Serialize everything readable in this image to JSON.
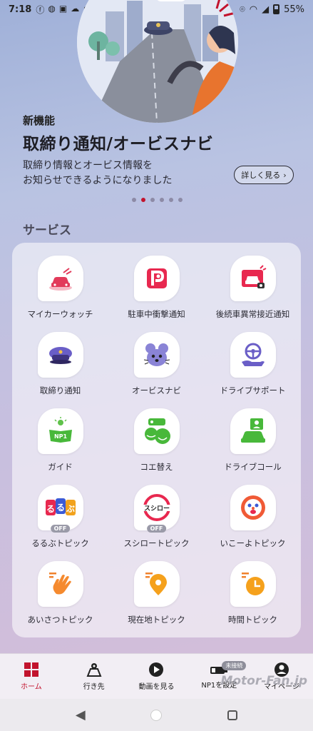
{
  "status_bar": {
    "time": "7:18",
    "battery": "55%",
    "left_icons": [
      "facebook-icon",
      "line-icon",
      "tiktok-icon",
      "weather-icon",
      "dot-icon"
    ],
    "right_icons": [
      "location-icon",
      "wifi-icon",
      "signal-icon",
      "battery-icon"
    ]
  },
  "hero": {
    "badge": "新機能",
    "title": "取締り通知/オービスナビ",
    "description_line1": "取締り情報とオービス情報を",
    "description_line2": "お知らせできるようになりました",
    "more_label": "詳しく見る",
    "pager": {
      "count": 6,
      "active_index": 1
    }
  },
  "services": {
    "section_title": "サービス",
    "items": [
      {
        "label": "マイカーウォッチ",
        "icon": "car-watch-icon"
      },
      {
        "label": "駐車中衝撃通知",
        "icon": "parking-camera-icon"
      },
      {
        "label": "後続車異常接近通知",
        "icon": "rear-car-alert-icon"
      },
      {
        "label": "取締り通知",
        "icon": "police-cap-icon"
      },
      {
        "label": "オービスナビ",
        "icon": "mouse-mascot-icon"
      },
      {
        "label": "ドライブサポート",
        "icon": "steering-hand-icon"
      },
      {
        "label": "ガイド",
        "icon": "guide-book-icon"
      },
      {
        "label": "コエ替え",
        "icon": "voice-change-icon"
      },
      {
        "label": "ドライブコール",
        "icon": "drive-call-icon"
      },
      {
        "label": "るるぶトピック",
        "icon": "rurubu-icon",
        "badge": "OFF"
      },
      {
        "label": "スシロートピック",
        "icon": "sushiro-icon",
        "badge": "OFF"
      },
      {
        "label": "いこーよトピック",
        "icon": "ikoyo-icon"
      },
      {
        "label": "あいさつトピック",
        "icon": "wave-hand-icon"
      },
      {
        "label": "現在地トピック",
        "icon": "location-pin-icon"
      },
      {
        "label": "時間トピック",
        "icon": "clock-icon"
      }
    ]
  },
  "bottom_nav": {
    "items": [
      {
        "label": "ホーム",
        "icon": "home-grid-icon",
        "active": true
      },
      {
        "label": "行き先",
        "icon": "map-pin-icon"
      },
      {
        "label": "動画を見る",
        "icon": "play-icon"
      },
      {
        "label": "NP1を設定",
        "icon": "device-icon",
        "badge": "未接続"
      },
      {
        "label": "マイページ",
        "icon": "user-icon"
      }
    ]
  },
  "watermark": "Motor-Fan.jp",
  "colors": {
    "accent": "#c2132d",
    "text": "#2a2a33"
  }
}
